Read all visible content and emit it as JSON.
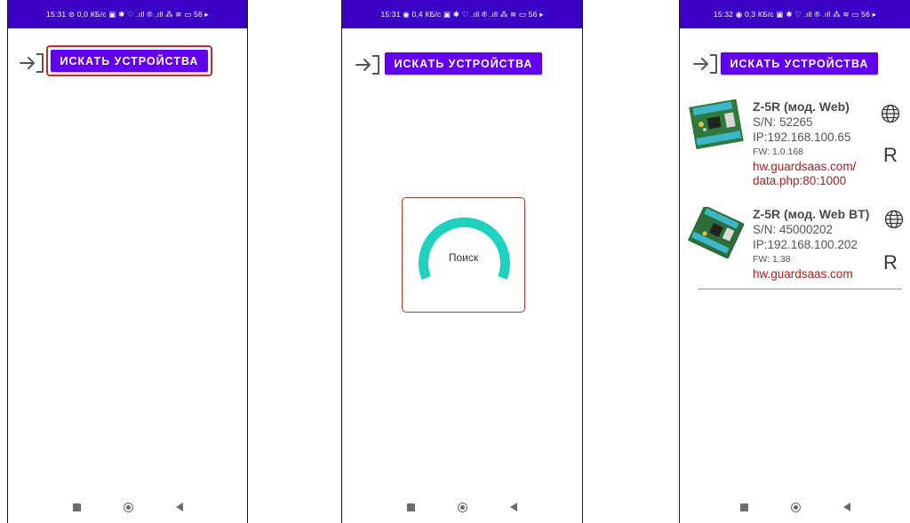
{
  "screens": [
    {
      "status": "15:31 ⊘  0,0 КБ/с ▣ ✱ ♡ .ıll ® .ıll ⁂ ≋ ▭ 56 ▸",
      "search_button": "ИСКАТЬ УСТРОЙСТВА"
    },
    {
      "status": "15:31 ◉  0,4 КБ/с ▣ ✱ ♡ .ıll ® .ıll ⁂ ≋ ▭ 56 ▸",
      "search_button": "ИСКАТЬ УСТРОЙСТВА",
      "progress_label": "Поиск"
    },
    {
      "status": "15:32 ◉  0,3 КБ/с ▣ ✱ ♡ .ıll ® .ıll ⁂ ≋ ▭ 56 ▸",
      "search_button": "ИСКАТЬ УСТРОЙСТВА",
      "devices": [
        {
          "title": "Z-5R (мод. Web)",
          "serial": "S/N: 52265",
          "ip": "IP:192.168.100.65",
          "fw": "FW: 1.0.168",
          "link_line1": "hw.guardsaas.com/",
          "link_line2": "data.php:80:1000",
          "mode_letter": "R"
        },
        {
          "title": "Z-5R (мод. Web BT)",
          "serial": "S/N: 45000202",
          "ip": "IP:192.168.100.202",
          "fw": "FW: 1.38",
          "link_line1": "hw.guardsaas.com",
          "mode_letter": "R"
        }
      ]
    }
  ],
  "colors": {
    "status_bar": "#3a00c4",
    "accent": "#6200ee",
    "highlight": "#cc2b2b",
    "progress": "#1fd1bf",
    "link": "#b71c1c"
  },
  "icons": {
    "login": "login-arrow-icon",
    "globe": "globe-icon",
    "nav_recent": "square-icon",
    "nav_home": "home-circle-icon",
    "nav_back": "back-triangle-icon"
  }
}
